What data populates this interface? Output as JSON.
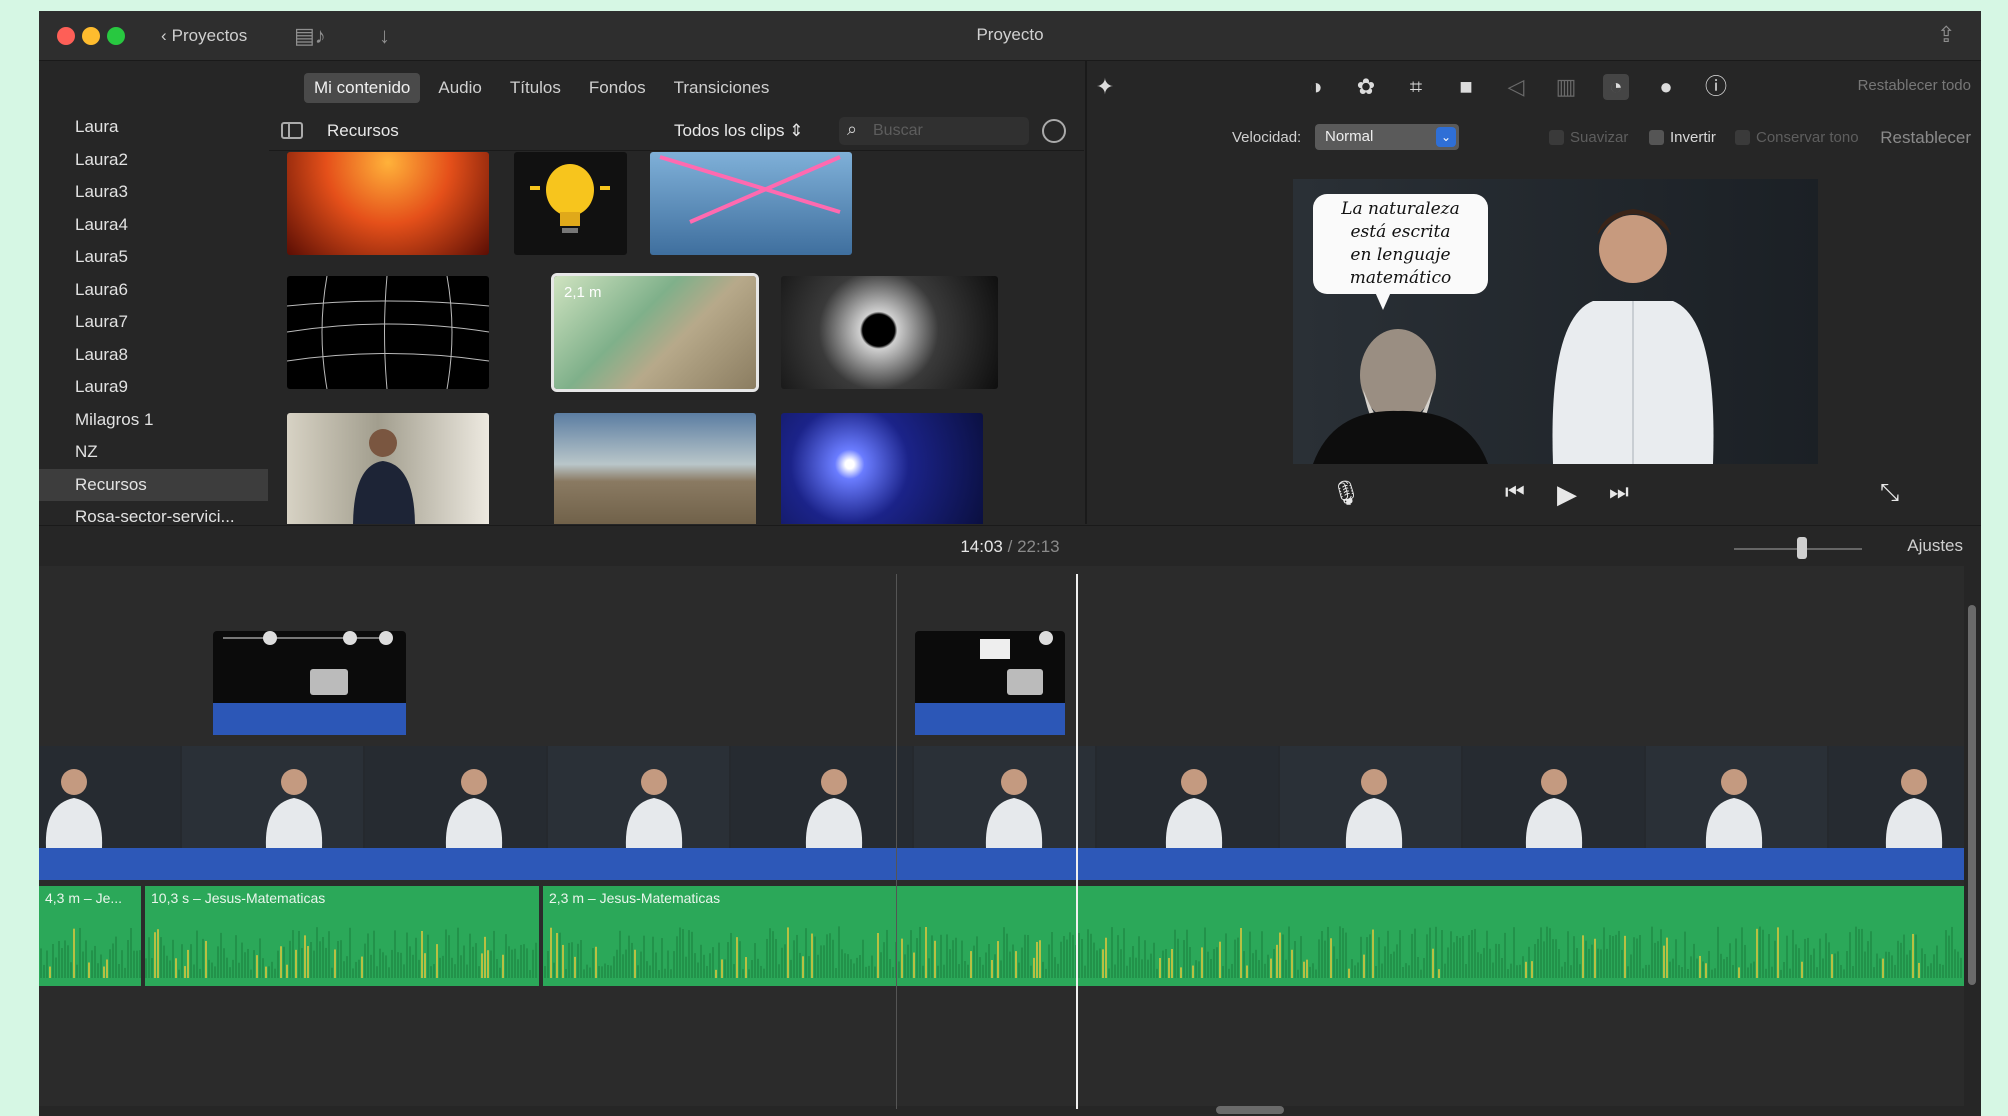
{
  "window": {
    "title": "Proyecto",
    "back_label": "Proyectos"
  },
  "browser": {
    "tabs": [
      "Mi contenido",
      "Audio",
      "Títulos",
      "Fondos",
      "Transiciones"
    ],
    "active_tab": "Mi contenido",
    "sidebar_items": [
      "Laura",
      "Laura2",
      "Laura3",
      "Laura4",
      "Laura5",
      "Laura6",
      "Laura7",
      "Laura8",
      "Laura9",
      "Milagros 1",
      "NZ",
      "Recursos",
      "Rosa-sector-servici..."
    ],
    "selected_item": "Recursos",
    "header_title": "Recursos",
    "clips_filter": "Todos los clips",
    "search_placeholder": "Buscar",
    "selected_thumb_label": "2,1 m"
  },
  "viewer": {
    "reset_all_label": "Restablecer todo",
    "speed_label": "Velocidad:",
    "speed_value": "Normal",
    "checkboxes": [
      "Suavizar",
      "Invertir",
      "Conservar tono"
    ],
    "reset_label": "Restablecer",
    "speech_bubble": [
      "La naturaleza",
      "está escrita",
      "en lenguaje",
      "matemático"
    ]
  },
  "timeline": {
    "current_time": "14:03",
    "separator": "/",
    "total_time": "22:13",
    "settings_label": "Ajustes",
    "audio_clips": [
      {
        "label": "4,3 m – Je..."
      },
      {
        "label": "10,3 s – Jesus-Matematicas"
      },
      {
        "label": "2,3 m – Jesus-Matematicas"
      }
    ]
  },
  "colors": {
    "accent_blue": "#2d58b8",
    "audio_green": "#2ba859",
    "traffic_red": "#fe5f57",
    "traffic_yellow": "#febc2e",
    "traffic_green": "#28c840"
  }
}
